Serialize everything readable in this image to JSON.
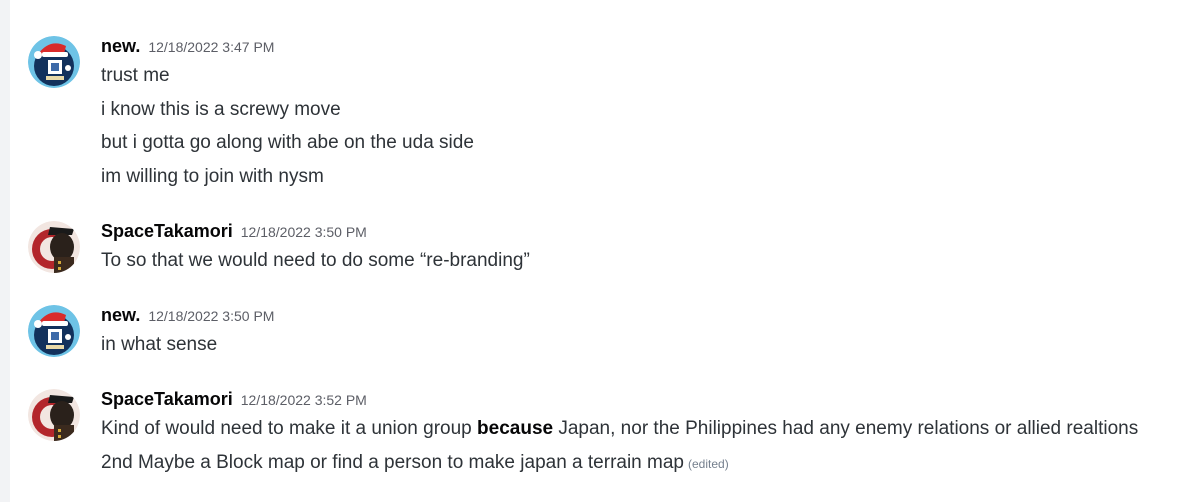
{
  "messages": [
    {
      "author": "new.",
      "timestamp": "12/18/2022 3:47 PM",
      "avatar_icon": "santa-hat-avatar-icon",
      "lines": [
        "trust me",
        "i know this is a screwy move",
        "but i gotta go along with abe on the uda side",
        "im willing to join with nysm"
      ]
    },
    {
      "author": "SpaceTakamori",
      "timestamp": "12/18/2022 3:50 PM",
      "avatar_icon": "red-gear-soldier-avatar-icon",
      "lines": [
        "To so that we would need to do some “re-branding”"
      ]
    },
    {
      "author": "new.",
      "timestamp": "12/18/2022 3:50 PM",
      "avatar_icon": "santa-hat-avatar-icon",
      "lines": [
        "in what sense"
      ]
    },
    {
      "author": "SpaceTakamori",
      "timestamp": "12/18/2022 3:52 PM",
      "avatar_icon": "red-gear-soldier-avatar-icon",
      "line1": {
        "before": "Kind of would need to make it a union group ",
        "bold": "because",
        "after": " Japan, nor the Philippines had any enemy relations or allied realtions"
      },
      "line2": "2nd Maybe a Block map or find a person to make japan a terrain map",
      "edited_label": "(edited)"
    }
  ],
  "colors": {
    "username": "#060607",
    "timestamp": "#5c5e66",
    "text": "#2e3338",
    "edited": "#747f8d"
  }
}
